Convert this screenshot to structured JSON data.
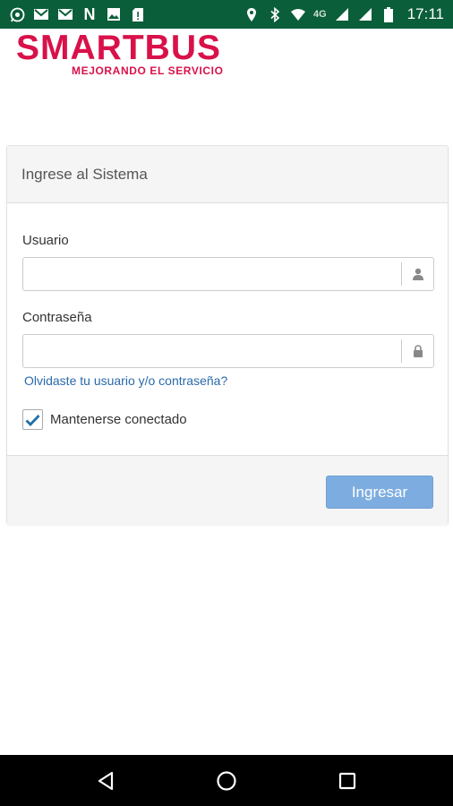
{
  "status_bar": {
    "time": "17:11",
    "network_label": "4G",
    "notification_icons": [
      "whatsapp-icon",
      "gmail-icon",
      "gmail-icon",
      "netflix-icon",
      "gallery-icon",
      "sim-alert-icon"
    ],
    "system_icons": [
      "location-icon",
      "bluetooth-icon",
      "wifi-icon",
      "signal-icon",
      "signal-icon",
      "battery-icon"
    ]
  },
  "logo": {
    "name": "SMARTBUS",
    "tagline": "MEJORANDO EL SERVICIO",
    "color": "#d9114a"
  },
  "login_panel": {
    "title": "Ingrese al Sistema",
    "username": {
      "label": "Usuario",
      "value": "",
      "icon": "user-icon"
    },
    "password": {
      "label": "Contraseña",
      "value": "",
      "icon": "lock-icon"
    },
    "forgot_link": "Olvidaste tu usuario y/o contraseña?",
    "remember": {
      "label": "Mantenerse conectado",
      "checked": true
    },
    "submit_label": "Ingresar"
  },
  "nav_bar": {
    "buttons": [
      "back-icon",
      "home-icon",
      "recents-icon"
    ]
  },
  "colors": {
    "status_bar": "#0b5e3a",
    "brand": "#d9114a",
    "link": "#2a6aaa",
    "button": "#7dade0",
    "checkmark": "#1e6fa8"
  }
}
